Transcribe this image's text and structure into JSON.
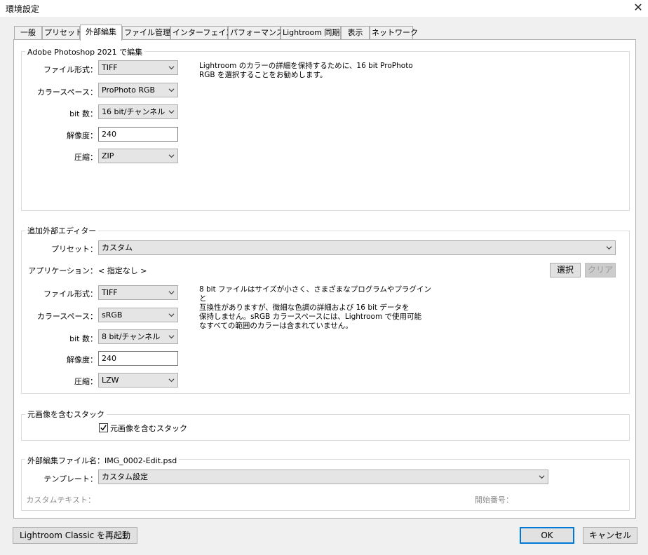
{
  "window": {
    "title": "環境設定",
    "close_glyph": "✕"
  },
  "tabs": [
    {
      "label": "一般"
    },
    {
      "label": "プリセット"
    },
    {
      "label": "外部編集",
      "active": true
    },
    {
      "label": "ファイル管理"
    },
    {
      "label": "インターフェイス"
    },
    {
      "label": "パフォーマンス"
    },
    {
      "label": "Lightroom 同期"
    },
    {
      "label": "表示"
    },
    {
      "label": "ネットワーク"
    }
  ],
  "photoshop": {
    "title": "Adobe Photoshop 2021 で編集",
    "file_format_label": "ファイル形式：",
    "file_format": "TIFF",
    "color_space_label": "カラースペース：",
    "color_space": "ProPhoto RGB",
    "bit_depth_label": "bit 数：",
    "bit_depth": "16 bit/チャンネル",
    "resolution_label": "解像度：",
    "resolution": "240",
    "compression_label": "圧縮：",
    "compression": "ZIP",
    "note_lines": [
      "Lightroom のカラーの詳細を保持するために、16 bit ProPhoto",
      "RGB を選択することをお勧めします。"
    ]
  },
  "additional": {
    "title": "追加外部エディター",
    "preset_label": "プリセット：",
    "preset": "カスタム",
    "application_label": "アプリケーション：",
    "application": "< 指定なし >",
    "choose_label": "選択",
    "clear_label": "クリア",
    "file_format_label": "ファイル形式：",
    "file_format": "TIFF",
    "color_space_label": "カラースペース：",
    "color_space": "sRGB",
    "bit_depth_label": "bit 数：",
    "bit_depth": "8 bit/チャンネル",
    "resolution_label": "解像度：",
    "resolution": "240",
    "compression_label": "圧縮：",
    "compression": "LZW",
    "note_lines": [
      "8 bit ファイルはサイズが小さく、さまざまなプログラムやプラグインと",
      "互換性がありますが、微細な色調の詳細および 16 bit データを",
      "保持しません。sRGB カラースペースには、Lightroom で使用可能",
      "なすべての範囲のカラーは含まれていません。"
    ]
  },
  "stack": {
    "title": "元画像を含むスタック",
    "checkbox_label": "元画像を含むスタック",
    "checked": true
  },
  "naming": {
    "title": "外部編集ファイル名：IMG_0002-Edit.psd",
    "template_label": "テンプレート：",
    "template": "カスタム設定",
    "custom_text_label": "カスタムテキスト：",
    "start_number_label": "開始番号："
  },
  "footer": {
    "restart_label": "Lightroom Classic を再起動",
    "ok_label": "OK",
    "cancel_label": "キャンセル"
  },
  "colors": {
    "accent": "#0078d7",
    "panel": "#ffffff",
    "window": "#f0f0f0"
  }
}
